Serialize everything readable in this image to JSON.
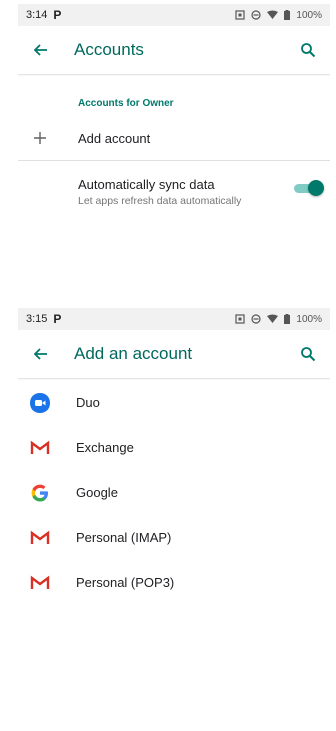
{
  "screen1": {
    "status": {
      "time": "3:14",
      "battery": "100%"
    },
    "title": "Accounts",
    "section_header": "Accounts for Owner",
    "add_account": "Add account",
    "sync": {
      "title": "Automatically sync data",
      "summary": "Let apps refresh data automatically",
      "enabled": true
    }
  },
  "screen2": {
    "status": {
      "time": "3:15",
      "battery": "100%"
    },
    "title": "Add an account",
    "accounts": [
      {
        "label": "Duo",
        "icon": "duo-icon"
      },
      {
        "label": "Exchange",
        "icon": "gmail-icon"
      },
      {
        "label": "Google",
        "icon": "google-icon"
      },
      {
        "label": "Personal (IMAP)",
        "icon": "gmail-icon"
      },
      {
        "label": "Personal (POP3)",
        "icon": "gmail-icon"
      }
    ]
  },
  "colors": {
    "accent": "#00796b",
    "title": "#00695c",
    "status_bar": "#f1f1f1"
  }
}
